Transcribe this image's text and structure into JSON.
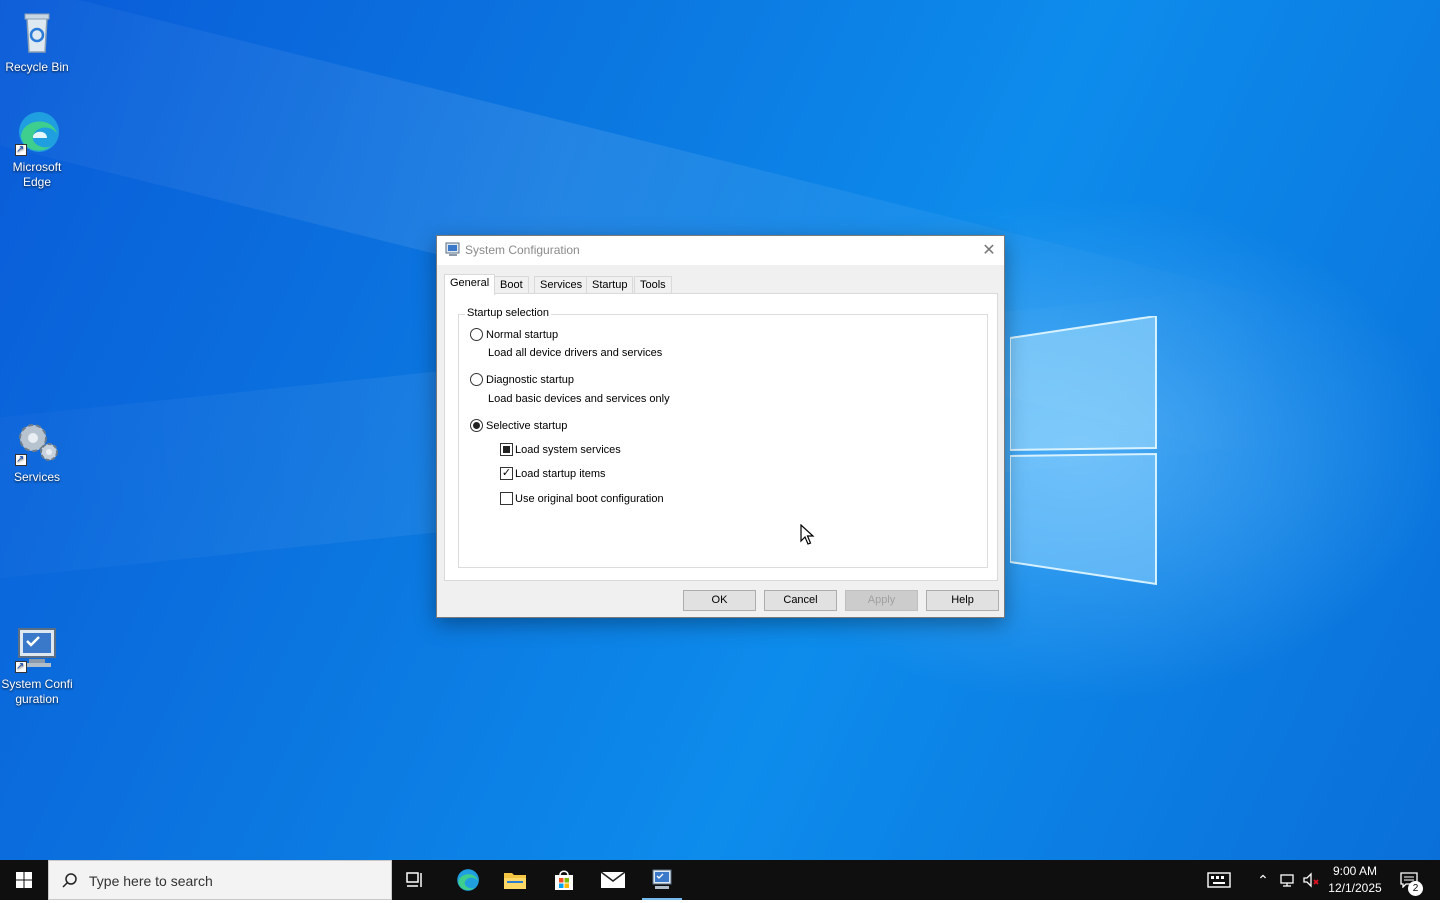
{
  "desktop": {
    "icons": [
      {
        "label": "Recycle Bin"
      },
      {
        "label": "Microsoft Edge"
      },
      {
        "label": "Services"
      },
      {
        "label": "System Configuration"
      }
    ]
  },
  "dialog": {
    "title": "System Configuration",
    "tabs": [
      "General",
      "Boot",
      "Services",
      "Startup",
      "Tools"
    ],
    "active_tab": "General",
    "group_label": "Startup selection",
    "options": {
      "normal": {
        "label": "Normal startup",
        "desc": "Load all device drivers and services",
        "selected": false
      },
      "diagnostic": {
        "label": "Diagnostic startup",
        "desc": "Load basic devices and services only",
        "selected": false
      },
      "selective": {
        "label": "Selective startup",
        "selected": true
      }
    },
    "checks": {
      "system_services": {
        "label": "Load system services",
        "state": "indeterminate"
      },
      "startup_items": {
        "label": "Load startup items",
        "state": "checked",
        "glyph": "✓"
      },
      "boot_config": {
        "label": "Use original boot configuration",
        "state": "unchecked"
      }
    },
    "buttons": {
      "ok": "OK",
      "cancel": "Cancel",
      "apply": "Apply",
      "help": "Help"
    }
  },
  "taskbar": {
    "search_placeholder": "Type here to search",
    "time": "9:00 AM",
    "date": "12/1/2025",
    "notification_count": "2"
  },
  "colors": {
    "desktop_blue": "#0b77e0",
    "taskbar": "#0f0f10",
    "active_indicator": "#76b9ed"
  }
}
